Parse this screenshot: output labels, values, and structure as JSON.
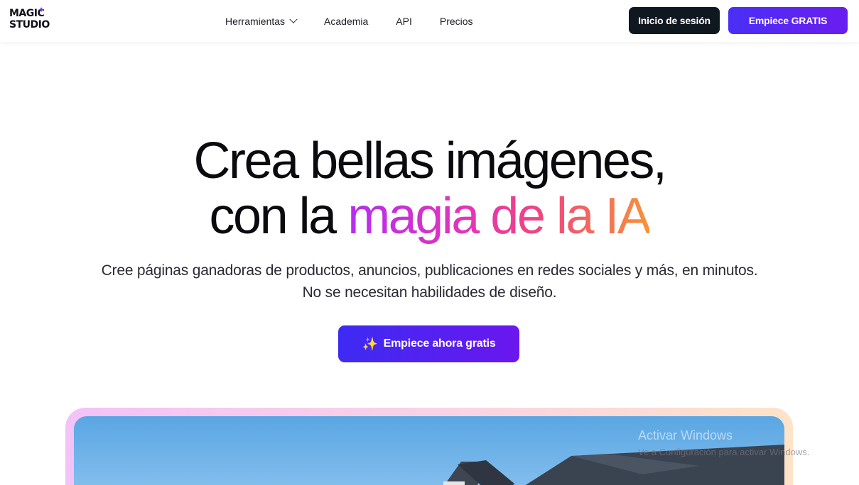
{
  "header": {
    "logo_line1": "MAGIC",
    "logo_line2": "STUDIO",
    "nav": [
      "Herramientas",
      "Academia",
      "API",
      "Precios"
    ],
    "login_label": "Inicio de sesión",
    "free_label": "Empiece GRATIS"
  },
  "hero": {
    "title_line1": "Crea bellas imágenes,",
    "title_line2_plain": "con la ",
    "title_line2_grad": "magia de la IA",
    "subtitle_line1": "Cree páginas ganadoras de productos, anuncios, publicaciones en redes sociales y más, en minutos.",
    "subtitle_line2": "No se necesitan habilidades de diseño.",
    "cta_label": "Empiece ahora gratis",
    "cta_icon": "sparkles-icon"
  },
  "watermark": {
    "title": "Activar Windows",
    "text": "Ve a Configuración para activar Windows."
  },
  "colors": {
    "accent": "#4a2ff5",
    "dark": "#0f1720",
    "gradient": [
      "#b52df0",
      "#e335b8",
      "#f2467c",
      "#f7923a"
    ]
  }
}
